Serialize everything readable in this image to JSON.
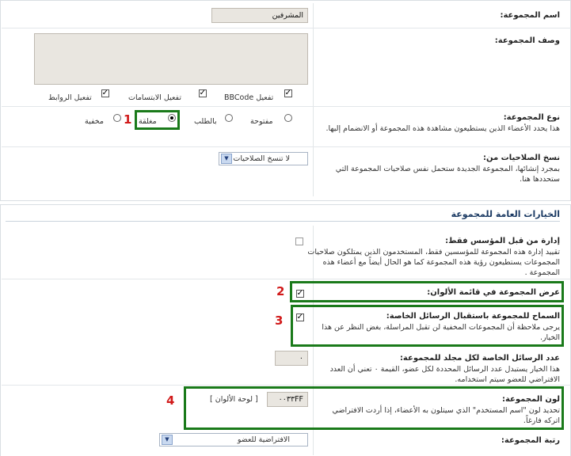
{
  "group": {
    "name_label": "اسم المجموعة:",
    "name_value": "المشرفين",
    "desc_label": "وصف المجموعة:",
    "desc_value": "",
    "enable_bbcode": "تفعيل BBCode",
    "enable_smilies": "تفعيل الابتسامات",
    "enable_links": "تفعيل الروابط",
    "type_label": "نوع المجموعة:",
    "type_desc": "هذا يحدد الأعضاء الذين يستطيعون مشاهدة هذه المجموعة أو الانضمام إليها.",
    "type_options": [
      "مفتوحة",
      "بالطلب",
      "مغلقة",
      "مخفية"
    ],
    "type_selected": "مغلقة",
    "copy_label": "نسخ الصلاحيات من:",
    "copy_desc": "بمجرد إنشائها، المجموعة الجديدة ستحمل نفس صلاحيات المجموعة التي ستحددها هنا.",
    "copy_select": "لا تنسخ الصلاحيات"
  },
  "general": {
    "title": "الخيارات العامة للمجموعة",
    "founder_label": "إدارة من قبل المؤسس فقط:",
    "founder_desc": "تقييد إدارة هذه المجموعة للمؤسسين فقط، المستخدمون الذين يمتلكون صلاحيات المجموعات يستطيعون رؤية هذه المجموعة كما هو الحال أيضاً مع أعضاء هذه المجموعة .",
    "legend_label": "عرض المجموعة في قائمة الألوان:",
    "pm_label": "السماح للمجموعة باستقبال الرسائل الخاصة:",
    "pm_desc": "يرجى ملاحظة أن المجموعات المخفية لن تقبل المراسلة، بغض النظر عن هذا الخيار.",
    "maxmsg_label": "عدد الرسائل الخاصة لكل مجلد للمجموعة:",
    "maxmsg_desc": "هذا الخيار يستبدل عدد الرسائل المحددة لكل عضو، القيمة ٠ تعني أن العدد الافتراضي للعضو سيتم استخدامه.",
    "maxmsg_value": "٠",
    "color_label": "لون المجموعة:",
    "color_desc": "تحديد لون \"اسم المستخدم\" الذي سيتلون به الأعضاء، إذا أردت الافتراضي اتركه فارغاً.",
    "color_value": "٠٠٣٣FF",
    "color_palette": "[ لوحة الألوان ]",
    "rank_label": "رتبة المجموعة:",
    "rank_select": "الافتراضية للعضو"
  },
  "markers": [
    "1",
    "2",
    "3",
    "4"
  ],
  "colors": {
    "highlight": "#1a7a1a",
    "marker": "#d11a1a",
    "section_title": "#1b3a63"
  }
}
